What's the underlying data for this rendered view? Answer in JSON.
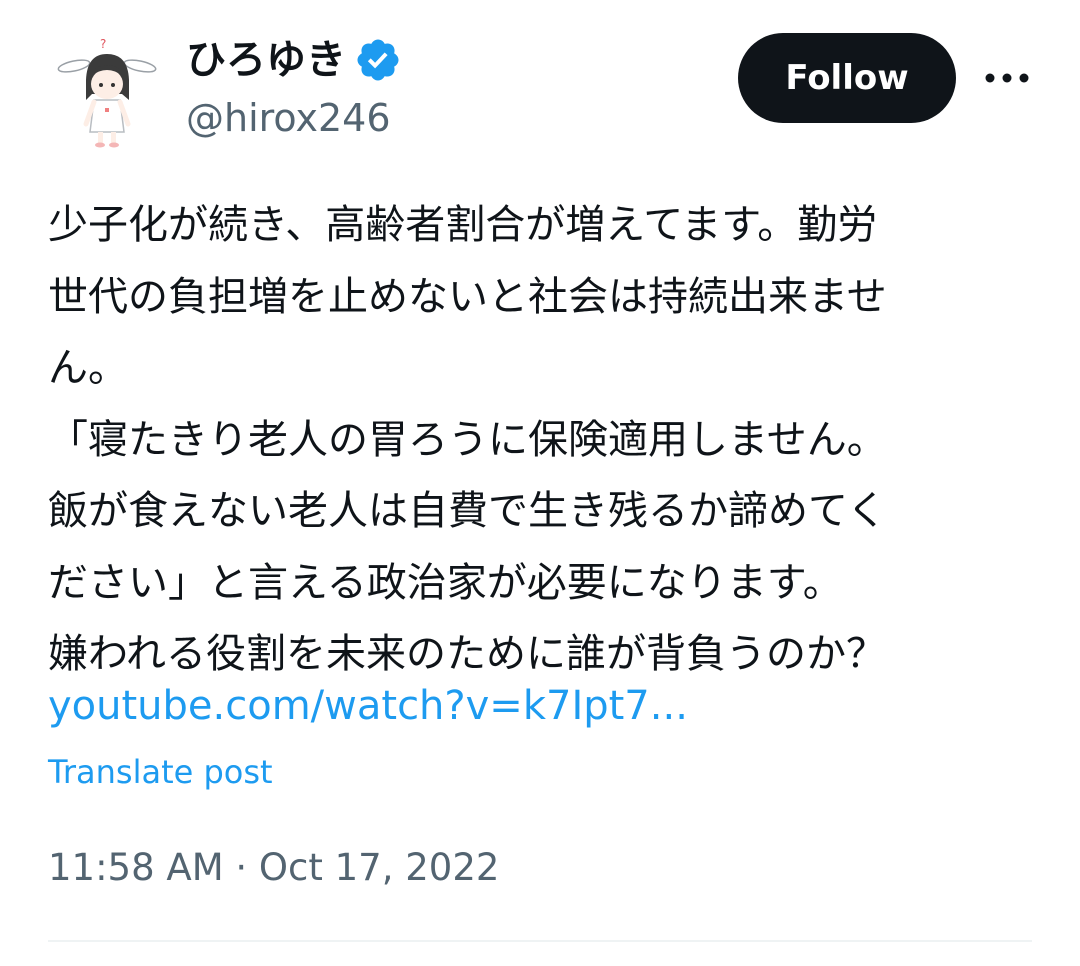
{
  "author": {
    "display_name": "ひろゆき",
    "handle": "@hirox246",
    "verified": true,
    "verified_color": "#1d9bf0"
  },
  "follow_button": {
    "label": "Follow"
  },
  "more_button": {
    "icon": "more-horizontal-icon"
  },
  "tweet": {
    "lines": [
      "少子化が続き、高齢者割合が増えてます。勤労",
      "世代の負担増を止めないと社会は持続出来ませ",
      "ん。",
      "「寝たきり老人の胃ろうに保険適用しません。",
      "飯が食えない老人は自費で生き残るか諦めてく",
      "ださい」と言える政治家が必要になります。",
      "嫌われる役割を未来のために誰が背負うのか？"
    ],
    "link": "youtube.com/watch?v=k7Ipt7...",
    "translate_label": "Translate post",
    "timestamp": "11:58 AM · Oct 17, 2022"
  },
  "colors": {
    "text": "#0f1419",
    "secondary": "#536471",
    "link": "#1d9bf0",
    "button_bg": "#0f1419"
  }
}
